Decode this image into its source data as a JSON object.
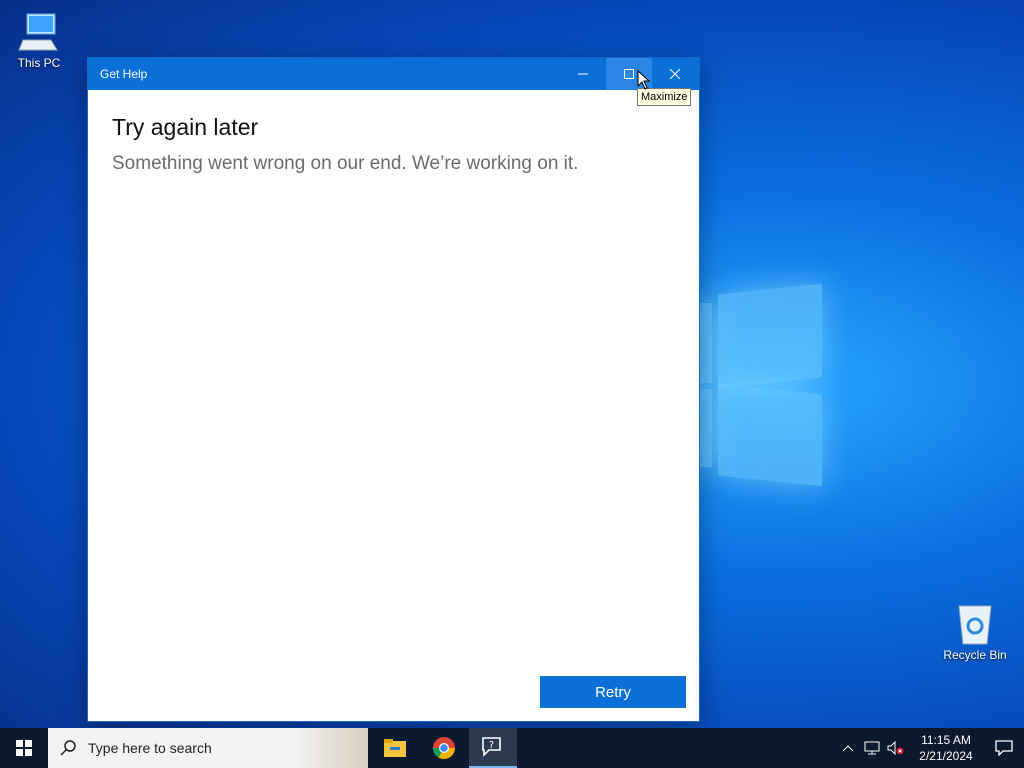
{
  "desktop": {
    "icons": [
      {
        "label": "This PC"
      },
      {
        "label": "Recycle Bin"
      }
    ]
  },
  "window": {
    "title": "Get Help",
    "heading": "Try again later",
    "message": "Something went wrong on our end. We’re working on it.",
    "retry_label": "Retry",
    "controls": {
      "minimize": "minimize-icon",
      "maximize": "maximize-icon",
      "close": "close-icon"
    }
  },
  "tooltip": {
    "text": "Maximize"
  },
  "taskbar": {
    "search_placeholder": "Type here to search",
    "apps": [
      {
        "name": "file-explorer-icon"
      },
      {
        "name": "chrome-icon"
      },
      {
        "name": "get-help-icon",
        "active": true
      }
    ],
    "clock": {
      "time": "11:15 AM",
      "date": "2/21/2024"
    }
  },
  "colors": {
    "accent": "#0a6fd6",
    "taskbar": "#0b1a2e"
  }
}
